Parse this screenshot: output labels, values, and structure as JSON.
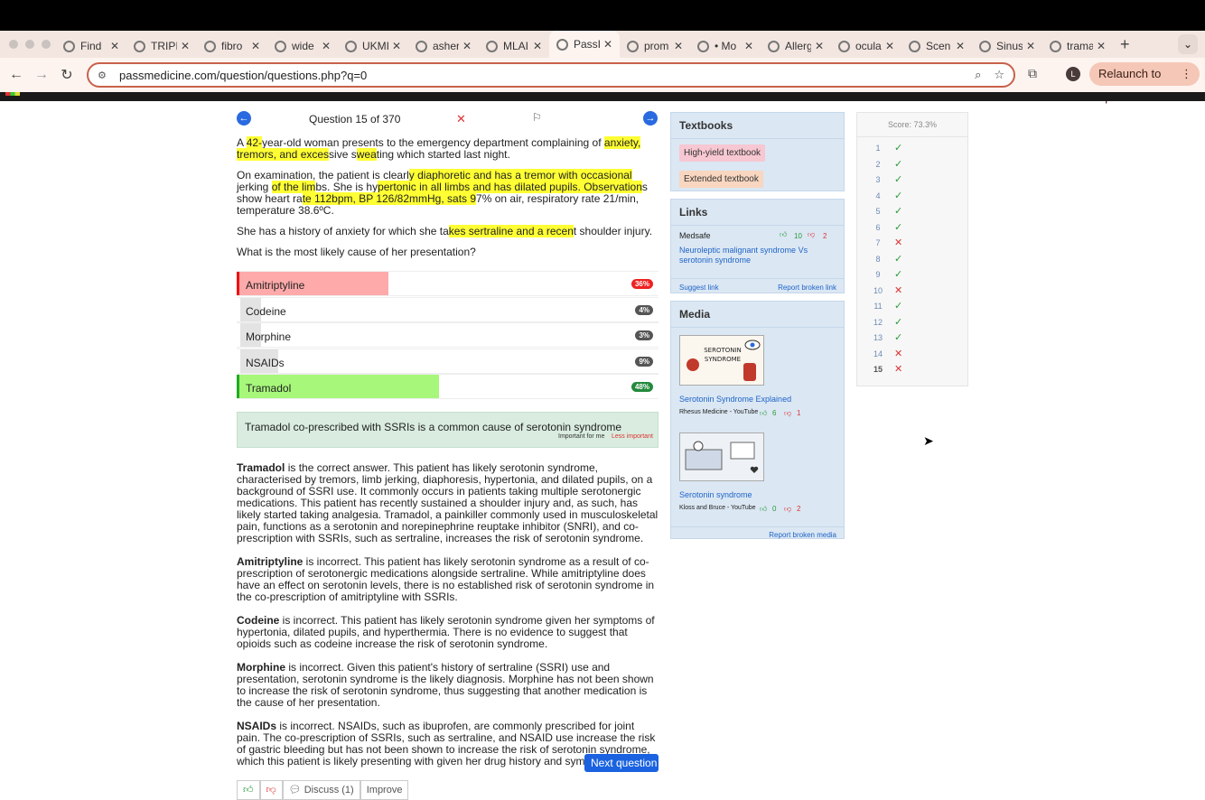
{
  "browser": {
    "tabs": [
      {
        "label": "Find",
        "icon": "face-icon"
      },
      {
        "label": "TRIPI",
        "icon": "google-icon"
      },
      {
        "label": "fibro",
        "icon": "google-icon"
      },
      {
        "label": "wide",
        "icon": "google-icon"
      },
      {
        "label": "UKMI",
        "icon": "ukmi-icon"
      },
      {
        "label": "asher",
        "icon": "google-icon"
      },
      {
        "label": "MLAI",
        "icon": "mla-icon"
      },
      {
        "label": "PassI",
        "icon": "passmedicine-icon",
        "active": true
      },
      {
        "label": "prom",
        "icon": "google-icon"
      },
      {
        "label": "• Mo",
        "icon": "google-icon"
      },
      {
        "label": "Allerg",
        "icon": "bmj-icon"
      },
      {
        "label": "ocula",
        "icon": "google-icon"
      },
      {
        "label": "Scen",
        "icon": "n-icon"
      },
      {
        "label": "Sinus",
        "icon": "n-icon"
      },
      {
        "label": "trama",
        "icon": "google-icon"
      }
    ],
    "url": "passmedicine.com/question/questions.php?q=0",
    "profile_initial": "L",
    "relaunch_label": "Relaunch to update"
  },
  "question": {
    "counter": "Question 15 of 370",
    "stem": [
      [
        {
          "t": "A "
        },
        {
          "t": "42-",
          "h": true
        },
        {
          "t": "year-old woman presents to the emergency department complaining of "
        },
        {
          "t": "anxiety, tremors, and exces",
          "h": true
        },
        {
          "t": "sive s"
        },
        {
          "t": "wea",
          "h": true
        },
        {
          "t": "ting which started last night."
        }
      ],
      [
        {
          "t": "On examination, the patient is clearl"
        },
        {
          "t": "y diaphoretic and has a tremor with occasional ",
          "h": true
        },
        {
          "t": "jerking "
        },
        {
          "t": "of the lim",
          "h": true
        },
        {
          "t": "bs. She is hy"
        },
        {
          "t": "pertonic in all limbs and has dilated pupils. Observation",
          "h": true
        },
        {
          "t": "s show heart ra"
        },
        {
          "t": "te 112bpm, BP 126/82mmHg, sats 9",
          "h": true
        },
        {
          "t": "7% on air, respiratory rate 21/min, temperature 38.6ºC."
        }
      ],
      [
        {
          "t": "She has a history of anxiety for which she ta"
        },
        {
          "t": "kes sertraline and a recen",
          "h": true
        },
        {
          "t": "t shoulder injury."
        }
      ],
      [
        {
          "t": "What is the most likely cause of her presentation?"
        }
      ]
    ],
    "answers": [
      {
        "label": "Amitriptyline",
        "percent": "36%",
        "value": 0.36,
        "state": "wrong"
      },
      {
        "label": "Codeine",
        "percent": "4%",
        "value": 0.04,
        "state": "plain"
      },
      {
        "label": "Morphine",
        "percent": "3%",
        "value": 0.03,
        "state": "plain"
      },
      {
        "label": "NSAIDs",
        "percent": "9%",
        "value": 0.09,
        "state": "plain"
      },
      {
        "label": "Tramadol",
        "percent": "48%",
        "value": 0.48,
        "state": "right"
      }
    ],
    "key_point": "Tramadol co-prescribed with SSRIs is a common cause of serotonin syndrome",
    "important_label": "Important for me",
    "less_important_label": "Less important",
    "explanations": [
      {
        "bold": "Tramadol",
        "text": " is the correct answer. This patient has likely serotonin syndrome, characterised by tremors, limb jerking, diaphoresis, hypertonia, and dilated pupils, on a background of SSRI use. It commonly occurs in patients taking multiple serotonergic medications. This patient has recently sustained a shoulder injury and, as such, has likely started taking analgesia. Tramadol, a painkiller commonly used in musculoskeletal pain, functions as a serotonin and norepinephrine reuptake inhibitor (SNRI), and co-prescription with SSRIs, such as sertraline, increases the risk of serotonin syndrome."
      },
      {
        "bold": "Amitriptyline",
        "text": " is incorrect. This patient has likely serotonin syndrome as a result of co-prescription of serotonergic medications alongside sertraline. While amitriptyline does have an effect on serotonin levels, there is no established risk of serotonin syndrome in the co-prescription of amitriptyline with SSRIs."
      },
      {
        "bold": "Codeine",
        "text": " is incorrect. This patient has likely serotonin syndrome given her symptoms of hypertonia, dilated pupils, and hyperthermia. There is no evidence to suggest that opioids such as codeine increase the risk of serotonin syndrome."
      },
      {
        "bold": "Morphine",
        "text": " is incorrect. Given this patient's history of sertraline (SSRI) use and presentation, serotonin syndrome is the likely diagnosis. Morphine has not been shown to increase the risk of serotonin syndrome, thus suggesting that another medication is the cause of her presentation."
      },
      {
        "bold": "NSAIDs",
        "text": " is incorrect. NSAIDs, such as ibuprofen, are commonly prescribed for joint pain. The co-prescription of SSRIs, such as sertraline, and NSAID use increase the risk of gastric bleeding but has not been shown to increase the risk of serotonin syndrome, which this patient is likely presenting with given her drug history and symptoms."
      }
    ],
    "discuss_label": "Discuss (1)",
    "improve_label": "Improve",
    "next_label": "Next question"
  },
  "textbooks": {
    "title": "Textbooks",
    "high_yield": "High-yield textbook",
    "extended": "Extended textbook"
  },
  "links": {
    "title": "Links",
    "source": "Medsafe",
    "up": "10",
    "down": "2",
    "link_title": "Neuroleptic malignant syndrome Vs serotonin syndrome",
    "suggest": "Suggest link",
    "report": "Report broken link"
  },
  "media": {
    "title": "Media",
    "items": [
      {
        "title": "Serotonin Syndrome Explained",
        "source": "Rhesus Medicine - YouTube",
        "up": "6",
        "down": "1"
      },
      {
        "title": "Serotonin syndrome",
        "source": "Kloss and Bruce - YouTube",
        "up": "0",
        "down": "2"
      }
    ],
    "report": "Report broken media"
  },
  "score": {
    "title": "Score: 73.3%",
    "rows": [
      {
        "n": "1",
        "ok": true
      },
      {
        "n": "2",
        "ok": true
      },
      {
        "n": "3",
        "ok": true
      },
      {
        "n": "4",
        "ok": true
      },
      {
        "n": "5",
        "ok": true
      },
      {
        "n": "6",
        "ok": true
      },
      {
        "n": "7",
        "ok": false
      },
      {
        "n": "8",
        "ok": true
      },
      {
        "n": "9",
        "ok": true
      },
      {
        "n": "10",
        "ok": false
      },
      {
        "n": "11",
        "ok": true
      },
      {
        "n": "12",
        "ok": true
      },
      {
        "n": "13",
        "ok": true
      },
      {
        "n": "14",
        "ok": false
      },
      {
        "n": "15",
        "ok": false
      }
    ]
  }
}
